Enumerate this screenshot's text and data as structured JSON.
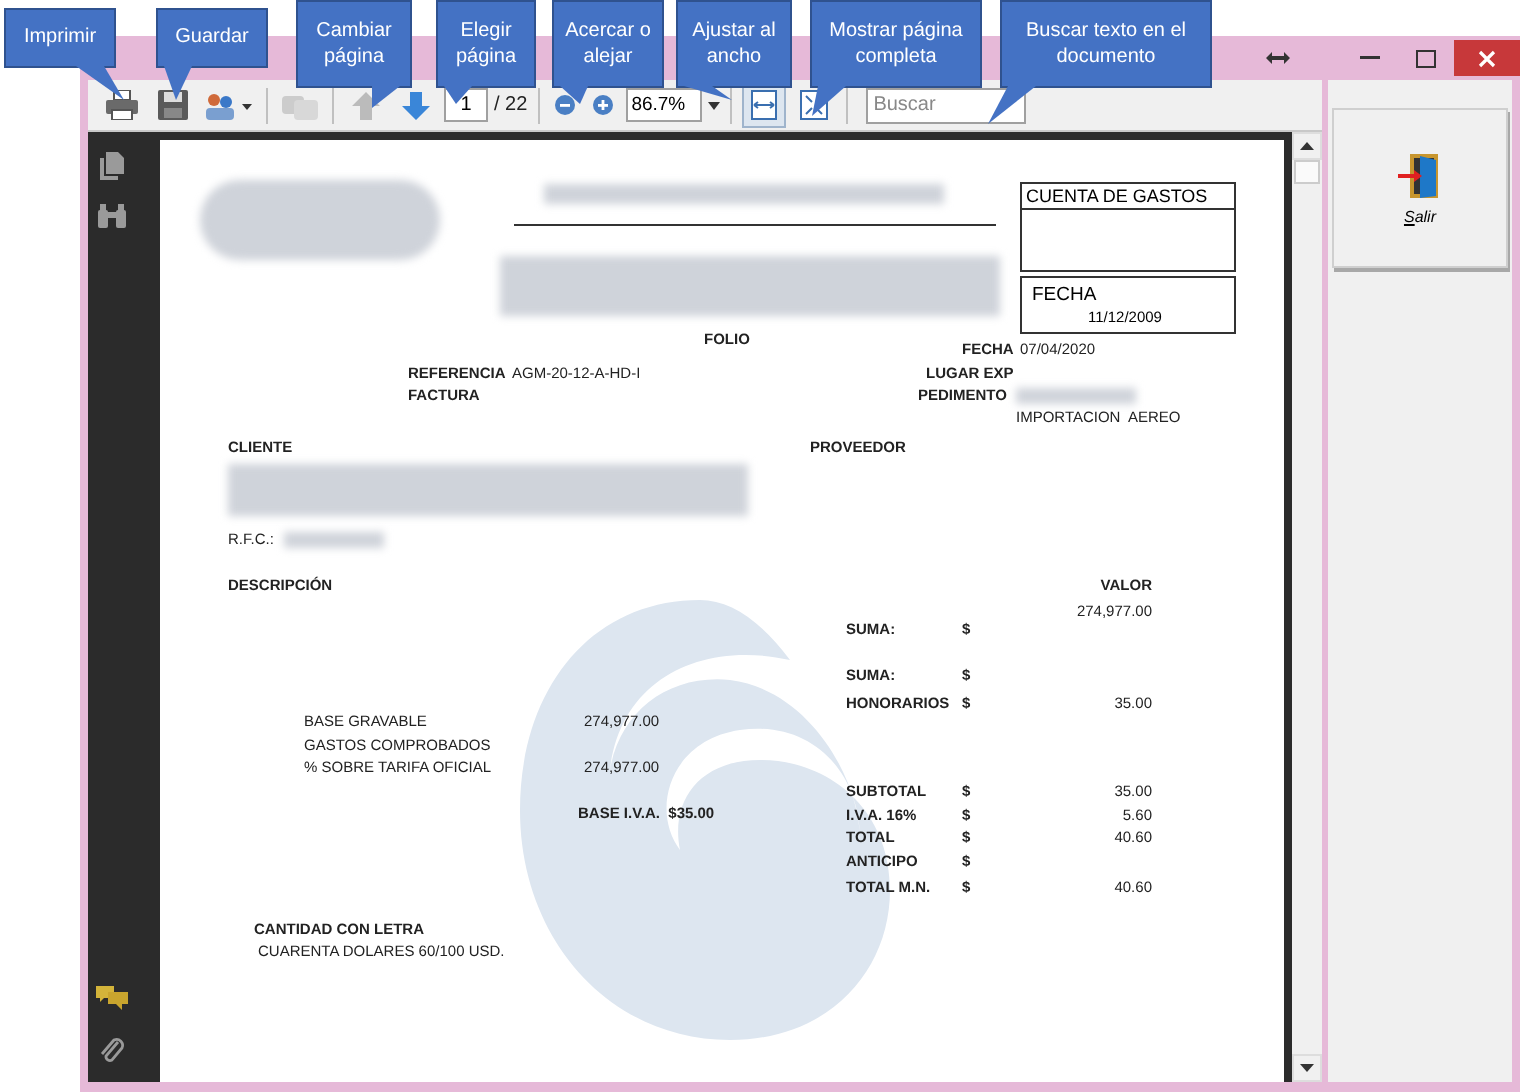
{
  "callouts": [
    {
      "text": "Imprimir"
    },
    {
      "text": "Guardar"
    },
    {
      "text": "Cambiar página"
    },
    {
      "text": "Elegir página"
    },
    {
      "text": "Acercar o alejar"
    },
    {
      "text": "Ajustar al ancho"
    },
    {
      "text": "Mostrar página completa"
    },
    {
      "text": "Buscar texto en el documento"
    }
  ],
  "toolbar": {
    "page_number": "1",
    "page_total": "/ 22",
    "zoom": "86.7%",
    "search": {
      "placeholder": "Buscar"
    },
    "fit_width_selected": true
  },
  "document": {
    "title_box": "CUENTA DE GASTOS",
    "date_box": {
      "label": "FECHA",
      "value": "11/12/2009"
    },
    "texts": [
      {
        "text": "FOLIO",
        "kind": "label"
      },
      {
        "text": "FECHA",
        "kind": "label"
      },
      {
        "text": "07/04/2020",
        "kind": "value"
      },
      {
        "text": "REFERENCIA",
        "kind": "label"
      },
      {
        "text": "AGM-20-12-A-HD-I",
        "kind": "value"
      },
      {
        "text": "LUGAR EXP",
        "kind": "label"
      },
      {
        "text": "FACTURA",
        "kind": "label"
      },
      {
        "text": "PEDIMENTO",
        "kind": "label"
      },
      {
        "text": "IMPORTACION",
        "kind": "value"
      },
      {
        "text": "AEREO",
        "kind": "value"
      },
      {
        "text": "CLIENTE",
        "kind": "label"
      },
      {
        "text": "PROVEEDOR",
        "kind": "label"
      },
      {
        "text": "R.F.C.:",
        "kind": "value"
      },
      {
        "text": "DESCRIPCIÓN",
        "kind": "label"
      },
      {
        "text": "VALOR",
        "kind": "label"
      },
      {
        "text": "274,977.00",
        "kind": "value"
      },
      {
        "text": "SUMA:",
        "kind": "label"
      },
      {
        "text": "$",
        "kind": "label"
      },
      {
        "text": "SUMA:",
        "kind": "label"
      },
      {
        "text": "$",
        "kind": "label"
      },
      {
        "text": "HONORARIOS",
        "kind": "label"
      },
      {
        "text": "$",
        "kind": "label"
      },
      {
        "text": "35.00",
        "kind": "value"
      },
      {
        "text": "BASE GRAVABLE",
        "kind": "value"
      },
      {
        "text": "274,977.00",
        "kind": "value"
      },
      {
        "text": "GASTOS COMPROBADOS",
        "kind": "value"
      },
      {
        "text": "% SOBRE TARIFA OFICIAL",
        "kind": "value"
      },
      {
        "text": "274,977.00",
        "kind": "value"
      },
      {
        "text": "SUBTOTAL",
        "kind": "label"
      },
      {
        "text": "$",
        "kind": "label"
      },
      {
        "text": "35.00",
        "kind": "value"
      },
      {
        "text": "BASE I.V.A.  $35.00",
        "kind": "label"
      },
      {
        "text": "I.V.A. 16%",
        "kind": "label"
      },
      {
        "text": "$",
        "kind": "label"
      },
      {
        "text": "5.60",
        "kind": "value"
      },
      {
        "text": "TOTAL",
        "kind": "label"
      },
      {
        "text": "$",
        "kind": "label"
      },
      {
        "text": "40.60",
        "kind": "value"
      },
      {
        "text": "ANTICIPO",
        "kind": "label"
      },
      {
        "text": "$",
        "kind": "label"
      },
      {
        "text": "TOTAL M.N.",
        "kind": "label"
      },
      {
        "text": "$",
        "kind": "label"
      },
      {
        "text": "40.60",
        "kind": "value"
      },
      {
        "text": "CANTIDAD CON LETRA",
        "kind": "label"
      },
      {
        "text": "CUARENTA DOLARES 60/100 USD.",
        "kind": "value"
      }
    ]
  },
  "side_panel": {
    "exit_button": "Salir"
  }
}
